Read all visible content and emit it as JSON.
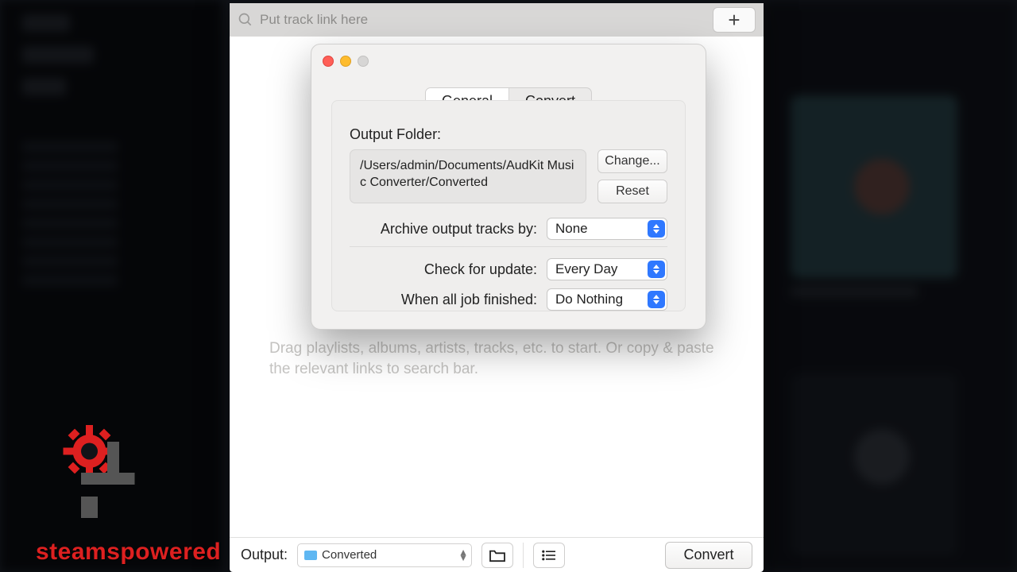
{
  "search": {
    "placeholder": "Put track link here"
  },
  "hint": "Drag playlists, albums, artists, tracks, etc. to start. Or copy & paste the relevant links to search bar.",
  "bottom": {
    "output_label": "Output:",
    "output_folder_name": "Converted",
    "convert": "Convert"
  },
  "prefs": {
    "tabs": {
      "general": "General",
      "convert": "Convert"
    },
    "output_folder_label": "Output Folder:",
    "output_folder_path": "/Users/admin/Documents/AudKit Music Converter/Converted",
    "change": "Change...",
    "reset": "Reset",
    "archive_label": "Archive output tracks by:",
    "archive_value": "None",
    "update_label": "Check for update:",
    "update_value": "Every Day",
    "finished_label": "When all job finished:",
    "finished_value": "Do Nothing"
  },
  "watermark": "steamspowered"
}
